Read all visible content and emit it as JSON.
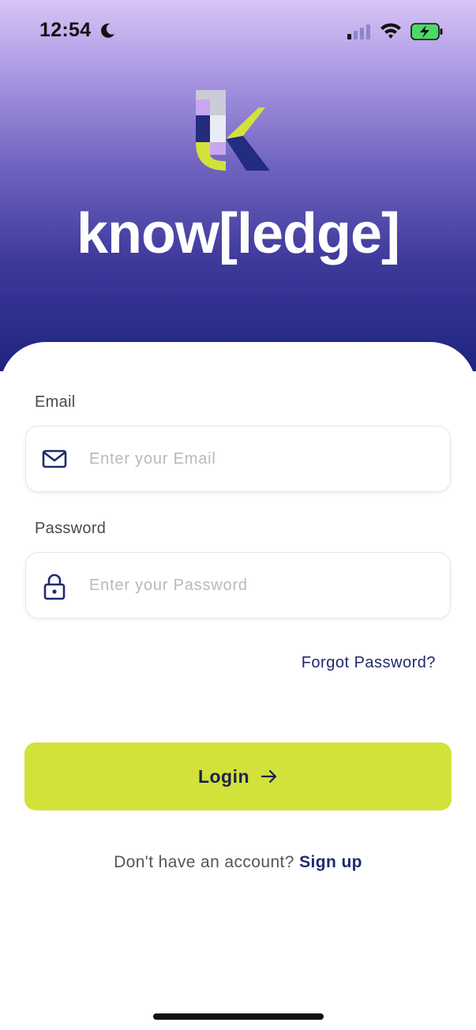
{
  "status_bar": {
    "time": "12:54",
    "moon_icon": "moon-icon",
    "signal_icon": "cellular-signal-icon",
    "wifi_icon": "wifi-icon",
    "battery_icon": "battery-charging-icon"
  },
  "brand": {
    "logo_icon": "k-logo-icon",
    "name": "know[ledge]"
  },
  "form": {
    "email_label": "Email",
    "email_placeholder": "Enter your Email",
    "email_value": "",
    "email_icon": "envelope-icon",
    "password_label": "Password",
    "password_placeholder": "Enter your Password",
    "password_value": "",
    "password_icon": "lock-icon",
    "forgot_label": "Forgot Password?",
    "login_label": "Login",
    "login_icon": "arrow-right-icon"
  },
  "signup": {
    "prompt": "Don't have an account?",
    "link_label": "Sign up"
  },
  "colors": {
    "accent": "#d2e23a",
    "navy": "#1f2a6e",
    "gradient_top": "#d8c4f6",
    "gradient_bottom": "#1f2380"
  }
}
